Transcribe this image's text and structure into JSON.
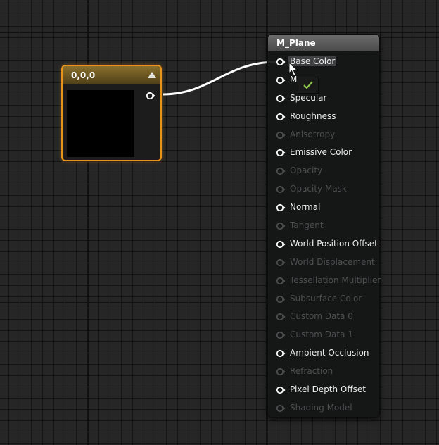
{
  "constant_node": {
    "title": "0,0,0",
    "preview_color": "#000000",
    "accent_color": "#e8931c",
    "icons": {
      "collapse": "triangle-up-icon",
      "output": "output-pin-icon"
    }
  },
  "material_node": {
    "title": "M_Plane",
    "pins": [
      {
        "label": "Base Color",
        "enabled": true
      },
      {
        "label": "Me",
        "enabled": true
      },
      {
        "label": "Specular",
        "enabled": true
      },
      {
        "label": "Roughness",
        "enabled": true
      },
      {
        "label": "Anisotropy",
        "enabled": false
      },
      {
        "label": "Emissive Color",
        "enabled": true
      },
      {
        "label": "Opacity",
        "enabled": false
      },
      {
        "label": "Opacity Mask",
        "enabled": false
      },
      {
        "label": "Normal",
        "enabled": true
      },
      {
        "label": "Tangent",
        "enabled": false
      },
      {
        "label": "World Position Offset",
        "enabled": true
      },
      {
        "label": "World Displacement",
        "enabled": false
      },
      {
        "label": "Tessellation Multiplier",
        "enabled": false
      },
      {
        "label": "Subsurface Color",
        "enabled": false
      },
      {
        "label": "Custom Data 0",
        "enabled": false
      },
      {
        "label": "Custom Data 1",
        "enabled": false
      },
      {
        "label": "Ambient Occlusion",
        "enabled": true
      },
      {
        "label": "Refraction",
        "enabled": false
      },
      {
        "label": "Pixel Depth Offset",
        "enabled": true
      },
      {
        "label": "Shading Model",
        "enabled": false
      }
    ]
  },
  "drag_tooltip": {
    "icon": "checkmark-icon"
  },
  "colors": {
    "graph_background": "#262626",
    "wire": "#ffffff",
    "check": "#8bc34a"
  }
}
